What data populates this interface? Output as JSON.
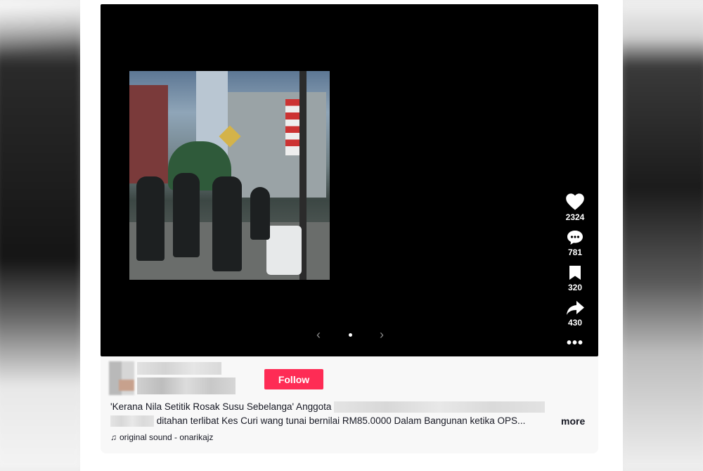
{
  "actions": {
    "likes": "2324",
    "comments": "781",
    "saves": "320",
    "shares": "430"
  },
  "pager": {
    "prev": "‹",
    "next": "›"
  },
  "author": {
    "follow_label": "Follow"
  },
  "caption": {
    "line1_prefix": "'Kerana Nila Setitik Rosak Susu Sebelanga' Anggota",
    "line2_suffix": "ditahan terlibat Kes Curi wang tunai bernilai RM85.0000 Dalam Bangunan ketika OPS...",
    "more_label": "more"
  },
  "sound": {
    "icon": "music-note-icon",
    "label": "original sound - onarikajz"
  },
  "colors": {
    "follow": "#fe2c55",
    "video_bg": "#000000"
  }
}
